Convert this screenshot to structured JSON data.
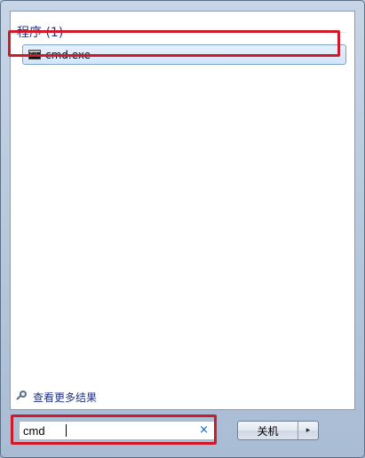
{
  "results": {
    "group_header": "程序 (1)",
    "items": [
      {
        "label": "cmd.exe",
        "icon": "cmd-icon"
      }
    ],
    "see_more": "查看更多结果"
  },
  "search": {
    "value": "cmd",
    "clear_glyph": "×"
  },
  "power": {
    "shutdown_label": "关机",
    "arrow_glyph": "▸"
  },
  "colors": {
    "highlight": "#d01a2a",
    "link": "#1e3287",
    "selection": "#d2e5fa"
  }
}
